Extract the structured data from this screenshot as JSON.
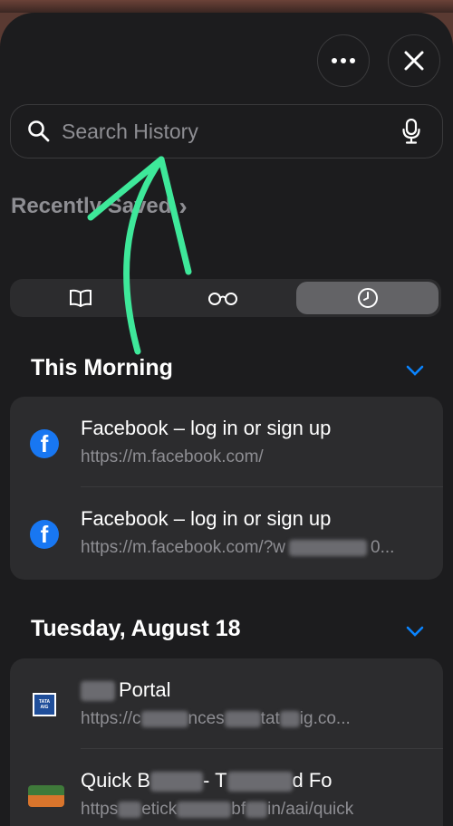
{
  "search": {
    "placeholder": "Search History"
  },
  "recently_saved": {
    "label": "Recently Saved",
    "chevron": "›"
  },
  "segments": [
    {
      "name": "bookmarks-icon"
    },
    {
      "name": "reading-list-icon"
    },
    {
      "name": "history-icon",
      "active": true
    }
  ],
  "sections": [
    {
      "title": "This Morning",
      "items": [
        {
          "title": "Facebook – log in or sign up",
          "url": "https://m.facebook.com/",
          "icon": "facebook-icon"
        },
        {
          "title": "Facebook – log in or sign up",
          "url": "https://m.facebook.com/?w",
          "url_suffix": "0...",
          "icon": "facebook-icon"
        }
      ]
    },
    {
      "title": "Tuesday, August 18",
      "items": [
        {
          "title": "Portal",
          "url": "https://c",
          "url_mid": "nces",
          "url_mid2": "tat",
          "url_suffix": "ig.co...",
          "icon": "tata-aig-icon",
          "badge": "TATA AIG"
        },
        {
          "title": "Quick B",
          "title_mid": "- T",
          "title_suffix": "d Fo",
          "url": "https",
          "url_mid": "etick",
          "url_mid2": "bf",
          "url_suffix": "in/aai/quick",
          "icon": "site-favicon"
        }
      ]
    }
  ]
}
